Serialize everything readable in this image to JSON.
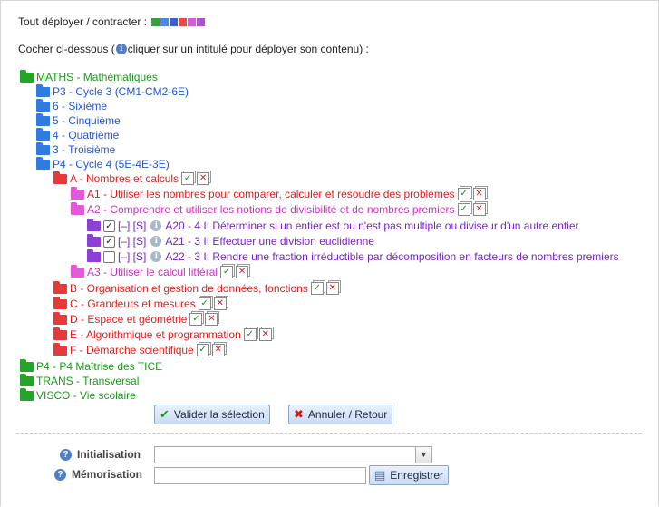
{
  "header": {
    "expand_label": "Tout déployer / contracter :",
    "intro_before": "Cocher ci-dessous (",
    "intro_after": " cliquer sur un intitulé pour déployer son contenu) :"
  },
  "colors": {
    "green": "#25a32a",
    "blue": "#2f7be0",
    "red": "#e8393a",
    "pink": "#e25ad6",
    "purple": "#8d3fd8"
  },
  "tree": {
    "maths": "MATHS - Mathématiques",
    "p3": "P3 - Cycle 3 (CM1-CM2-6E)",
    "sixieme": "6 - Sixième",
    "cinquieme": "5 - Cinquième",
    "quatrieme": "4 - Quatrième",
    "troisieme": "3 - Troisième",
    "p4": "P4 - Cycle 4 (5E-4E-3E)",
    "a": "A - Nombres et calculs",
    "a1": "A1 - Utiliser les nombres pour comparer, calculer et résoudre des problèmes",
    "a2": "A2 - Comprendre et utiliser les notions de divisibilité et de nombres premiers",
    "a20_prefix": "[–] [S]",
    "a20": "A20 - 4 II Déterminer si un entier est ou n'est pas multiple ou diviseur d'un autre entier",
    "a21_prefix": "[–] [S]",
    "a21": "A21 - 3 II Effectuer une division euclidienne",
    "a22_prefix": "[–] [S]",
    "a22": "A22 - 3 II Rendre une fraction irréductible par décomposition en facteurs de nombres premiers",
    "a3": "A3 - Utiliser le calcul littéral",
    "b": "B - Organisation et gestion de données, fonctions",
    "c": "C - Grandeurs et mesures",
    "d": "D - Espace et géométrie",
    "e": "E - Algorithmique et programmation",
    "f": "F - Démarche scientifique",
    "p4tice": "P4 - P4 Maîtrise des TICE",
    "trans": "TRANS - Transversal",
    "visco": "VISCO - Vie scolaire"
  },
  "buttons": {
    "validate": "Valider la sélection",
    "cancel": "Annuler / Retour",
    "save": "Enregistrer"
  },
  "form": {
    "init_label": "Initialisation",
    "init_value": "",
    "memo_label": "Mémorisation",
    "memo_value": ""
  }
}
